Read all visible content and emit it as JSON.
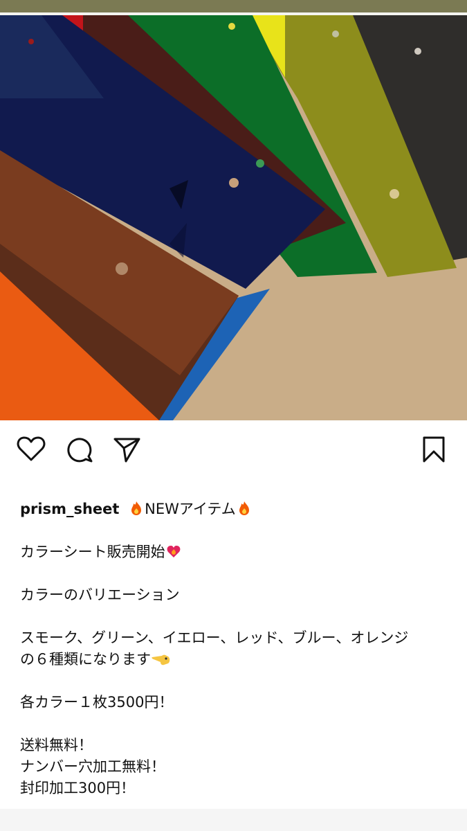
{
  "post": {
    "image_alt": "",
    "username": "prism_sheet",
    "headline": "NEWアイテム",
    "caption_lines": [
      "カラーシート販売開始",
      "カラーのバリエーション",
      "スモーク、グリーン、イエロー、レッド、ブルー、オレンジ",
      "の６種類になります",
      "各カラー１枚3500円！",
      "送料無料！",
      "ナンバー穴加工無料！",
      "封印加工300円！"
    ]
  },
  "actions": {
    "like": "heart-icon",
    "comment": "comment-icon",
    "share": "send-icon",
    "save": "bookmark-icon"
  },
  "colors": {
    "top_bar": "#7b7a53",
    "text": "#111111"
  }
}
